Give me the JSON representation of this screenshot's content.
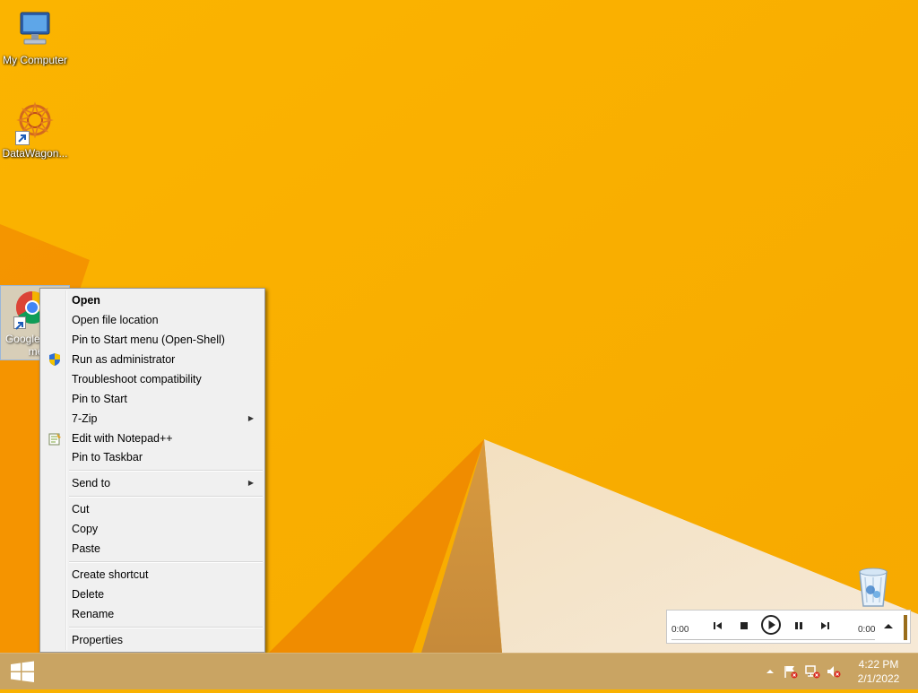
{
  "desktop": {
    "icons": [
      {
        "label": "My Computer"
      },
      {
        "label": "DataWagon..."
      },
      {
        "label": "Google Chrome"
      }
    ],
    "colors": {
      "wallpaper": "#f9b100",
      "taskbar": "#c9a463"
    }
  },
  "context_menu": {
    "items": [
      {
        "label": "Open",
        "bold": true
      },
      {
        "label": "Open file location"
      },
      {
        "label": "Pin to Start menu (Open-Shell)"
      },
      {
        "label": "Run as administrator",
        "icon": "uac-shield-icon"
      },
      {
        "label": "Troubleshoot compatibility"
      },
      {
        "label": "Pin to Start"
      },
      {
        "label": "7-Zip",
        "submenu": true
      },
      {
        "label": "Edit with Notepad++",
        "icon": "notepadpp-icon"
      },
      {
        "label": "Pin to Taskbar"
      },
      {
        "label": "Send to",
        "submenu": true
      },
      {
        "label": "Cut"
      },
      {
        "label": "Copy"
      },
      {
        "label": "Paste"
      },
      {
        "label": "Create shortcut"
      },
      {
        "label": "Delete"
      },
      {
        "label": "Rename"
      },
      {
        "label": "Properties"
      }
    ]
  },
  "media_player": {
    "elapsed": "0:00",
    "duration": "0:00"
  },
  "taskbar": {
    "time": "4:22 PM",
    "date": "2/1/2022"
  }
}
